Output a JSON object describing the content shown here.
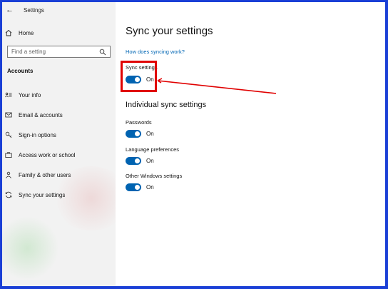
{
  "window": {
    "title": "Settings"
  },
  "sidebar": {
    "home_label": "Home",
    "search_placeholder": "Find a setting",
    "section_heading": "Accounts",
    "items": [
      {
        "label": "Your info",
        "icon": "person-card-icon"
      },
      {
        "label": "Email & accounts",
        "icon": "mail-icon"
      },
      {
        "label": "Sign-in options",
        "icon": "key-icon"
      },
      {
        "label": "Access work or school",
        "icon": "briefcase-icon"
      },
      {
        "label": "Family & other users",
        "icon": "person-icon"
      },
      {
        "label": "Sync your settings",
        "icon": "sync-icon"
      }
    ]
  },
  "main": {
    "title": "Sync your settings",
    "help_link": "How does syncing work?",
    "sync_settings": {
      "label": "Sync settings",
      "state": "On"
    },
    "individual_heading": "Individual sync settings",
    "individual": [
      {
        "label": "Passwords",
        "state": "On"
      },
      {
        "label": "Language preferences",
        "state": "On"
      },
      {
        "label": "Other Windows settings",
        "state": "On"
      }
    ]
  },
  "colors": {
    "accent": "#0063b1",
    "link": "#0066b4",
    "annotation": "#e00000",
    "frame": "#1a3fd6"
  }
}
